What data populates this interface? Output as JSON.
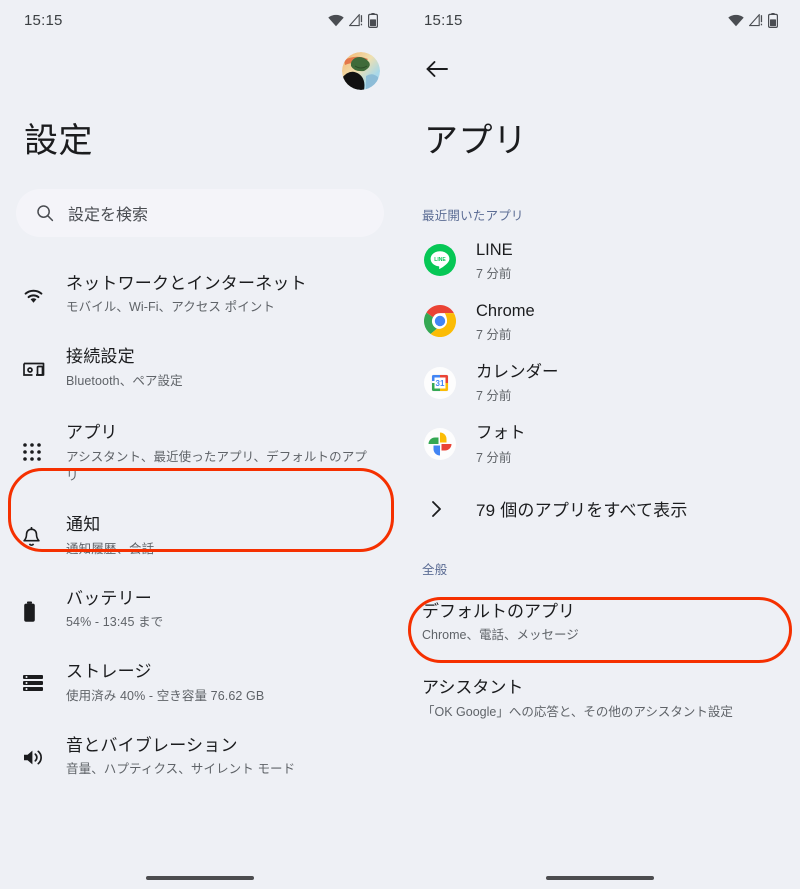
{
  "colors": {
    "background": "#eef0f5",
    "search_field": "#f4f4f9",
    "highlight": "#f53000",
    "section_heading": "#5b6c94",
    "primary_text": "#1b1c1e",
    "secondary_text": "#5f6368"
  },
  "left_panel": {
    "status_bar": {
      "time": "15:15",
      "icons": [
        "wifi-icon",
        "cell-signal-warning-icon",
        "battery-icon"
      ]
    },
    "avatar": "account-avatar",
    "title": "設定",
    "search": {
      "icon": "search-icon",
      "placeholder": "設定を検索"
    },
    "items": [
      {
        "icon": "wifi-icon",
        "title": "ネットワークとインターネット",
        "subtitle": "モバイル、Wi-Fi、アクセス ポイント",
        "highlighted": false
      },
      {
        "icon": "cast-connected-icon",
        "title": "接続設定",
        "subtitle": "Bluetooth、ペア設定",
        "highlighted": false
      },
      {
        "icon": "apps-grid-icon",
        "title": "アプリ",
        "subtitle": "アシスタント、最近使ったアプリ、デフォルトのアプリ",
        "highlighted": true
      },
      {
        "icon": "bell-icon",
        "title": "通知",
        "subtitle": "通知履歴、会話",
        "highlighted": false
      },
      {
        "icon": "battery-icon",
        "title": "バッテリー",
        "subtitle": "54% - 13:45 まで",
        "highlighted": false
      },
      {
        "icon": "storage-icon",
        "title": "ストレージ",
        "subtitle": "使用済み 40% - 空き容量 76.62 GB",
        "highlighted": false
      },
      {
        "icon": "volume-up-icon",
        "title": "音とバイブレーション",
        "subtitle": "音量、ハプティクス、サイレント モード",
        "highlighted": false
      }
    ]
  },
  "right_panel": {
    "status_bar": {
      "time": "15:15",
      "icons": [
        "wifi-icon",
        "cell-signal-warning-icon",
        "battery-icon"
      ]
    },
    "back_button": "back-arrow-icon",
    "title": "アプリ",
    "recent_section": {
      "heading": "最近開いたアプリ",
      "apps": [
        {
          "icon": "line-app-icon",
          "name": "LINE",
          "time": "7 分前"
        },
        {
          "icon": "chrome-app-icon",
          "name": "Chrome",
          "time": "7 分前"
        },
        {
          "icon": "calendar-app-icon",
          "name": "カレンダー",
          "time": "7 分前"
        },
        {
          "icon": "photos-app-icon",
          "name": "フォト",
          "time": "7 分前"
        }
      ],
      "see_all": {
        "icon": "chevron-right-icon",
        "label": "79 個のアプリをすべて表示",
        "highlighted": true
      }
    },
    "general_section": {
      "heading": "全般",
      "items": [
        {
          "title": "デフォルトのアプリ",
          "subtitle": "Chrome、電話、メッセージ"
        },
        {
          "title": "アシスタント",
          "subtitle": "「OK Google」への応答と、その他のアシスタント設定"
        }
      ]
    }
  }
}
